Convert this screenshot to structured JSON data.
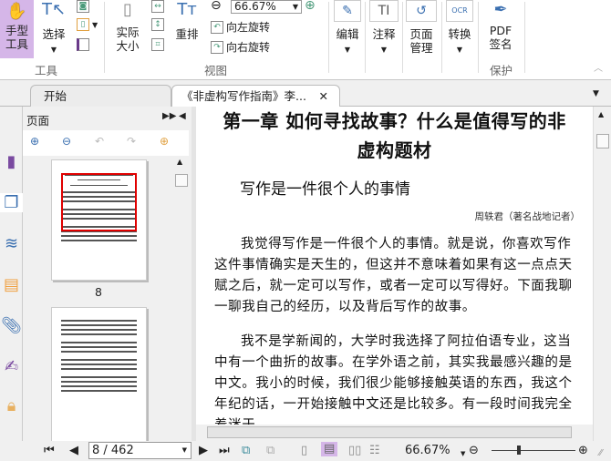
{
  "ribbon": {
    "hand_tool": "手型\n工具",
    "select": "选择",
    "actual_size": "实际\n大小",
    "reflow": "重排",
    "zoom_value": "66.67%",
    "rotate_left": "向左旋转",
    "rotate_right": "向右旋转",
    "edit": "编辑",
    "annotate": "注释",
    "page_manage": "页面\n管理",
    "convert": "转换",
    "pdf_sign": "PDF\n签名",
    "groups": {
      "tools": "工具",
      "view": "视图",
      "protect": "保护"
    }
  },
  "tabs": [
    {
      "label": "开始"
    },
    {
      "label": "《非虚构写作指南》李..."
    }
  ],
  "panel": {
    "title": "页面",
    "thumb_page": "8"
  },
  "document": {
    "title": "第一章  如何寻找故事？什么是值得写的非虚构题材",
    "subtitle": "写作是一件很个人的事情",
    "author": "周轶君（著名战地记者）",
    "paragraphs": [
      "我觉得写作是一件很个人的事情。就是说，你喜欢写作这件事情确实是天生的，但这并不意味着如果有这一点点天赋之后，就一定可以写作，或者一定可以写得好。下面我聊一聊我自己的经历，以及背后写作的故事。",
      "我不是学新闻的，大学时我选择了阿拉伯语专业，这当中有一个曲折的故事。在学外语之前，其实我最感兴趣的是中文。我小的时候，我们很少能够接触英语的东西，我这个年纪的话，一开始接触中文还是比较多。有一段时间我完全着迷于"
    ]
  },
  "status": {
    "page_input": "8 / 462",
    "zoom": "66.67%",
    "zoom_slider_fraction": 0.33
  },
  "colors": {
    "accent": "#d5b6e8",
    "highlight_border": "#e00000"
  }
}
